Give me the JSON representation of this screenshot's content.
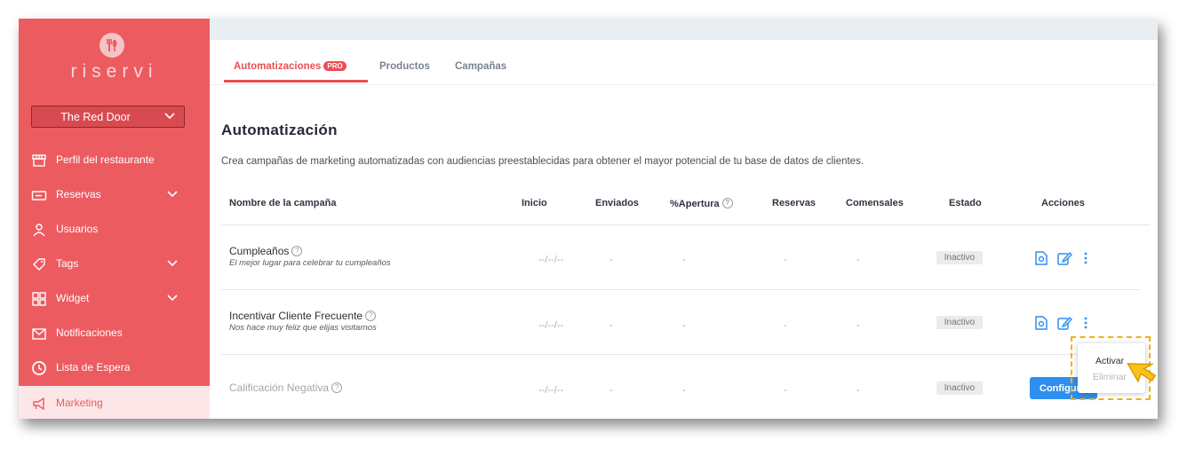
{
  "app": {
    "logo_text": "riservi"
  },
  "sidebar": {
    "restaurant": "The Red Door",
    "items": [
      {
        "label": "Perfil del restaurante",
        "icon": "storefront-icon"
      },
      {
        "label": "Reservas",
        "icon": "ticket-icon"
      },
      {
        "label": "Usuarios",
        "icon": "user-icon"
      },
      {
        "label": "Tags",
        "icon": "tag-icon"
      },
      {
        "label": "Widget",
        "icon": "widget-icon"
      },
      {
        "label": "Notificaciones",
        "icon": "mail-icon"
      },
      {
        "label": "Lista de Espera",
        "icon": "clock-icon"
      },
      {
        "label": "Marketing",
        "icon": "megaphone-icon"
      }
    ]
  },
  "tabs": [
    {
      "label": "Automatizaciones",
      "badge": "PRO"
    },
    {
      "label": "Productos"
    },
    {
      "label": "Campañas"
    }
  ],
  "page": {
    "title": "Automatización",
    "description": "Crea campañas de marketing automatizadas con audiencias preestablecidas para obtener el mayor potencial de tu base de datos de clientes."
  },
  "table": {
    "headers": [
      "Nombre de la campaña",
      "Inicio",
      "Enviados",
      "%Apertura",
      "Reservas",
      "Comensales",
      "Estado",
      "Acciones"
    ],
    "rows": [
      {
        "name": "Cumpleaños",
        "subtitle": "El mejor lugar para celebrar tu cumpleaños",
        "start": "--/--/--",
        "sent": "-",
        "open": "-",
        "reservations": "-",
        "diners": "-",
        "status": "Inactivo"
      },
      {
        "name": "Incentivar Cliente Frecuente",
        "subtitle": "Nos hace muy feliz que elijas visitarnos",
        "start": "--/--/--",
        "sent": "-",
        "open": "-",
        "reservations": "-",
        "diners": "-",
        "status": "Inactivo"
      },
      {
        "name": "Calificación Negativa",
        "subtitle": "",
        "start": "--/--/--",
        "sent": "-",
        "open": "-",
        "reservations": "-",
        "diners": "-",
        "status": "Inactivo",
        "button": "Configurar"
      }
    ]
  },
  "dropdown": {
    "activate": "Activar",
    "delete": "Eliminar"
  },
  "colors": {
    "brand": "#ec5b60",
    "accent": "#e94f55",
    "primary_button": "#2e8ff0",
    "highlight": "#f2b10d"
  }
}
